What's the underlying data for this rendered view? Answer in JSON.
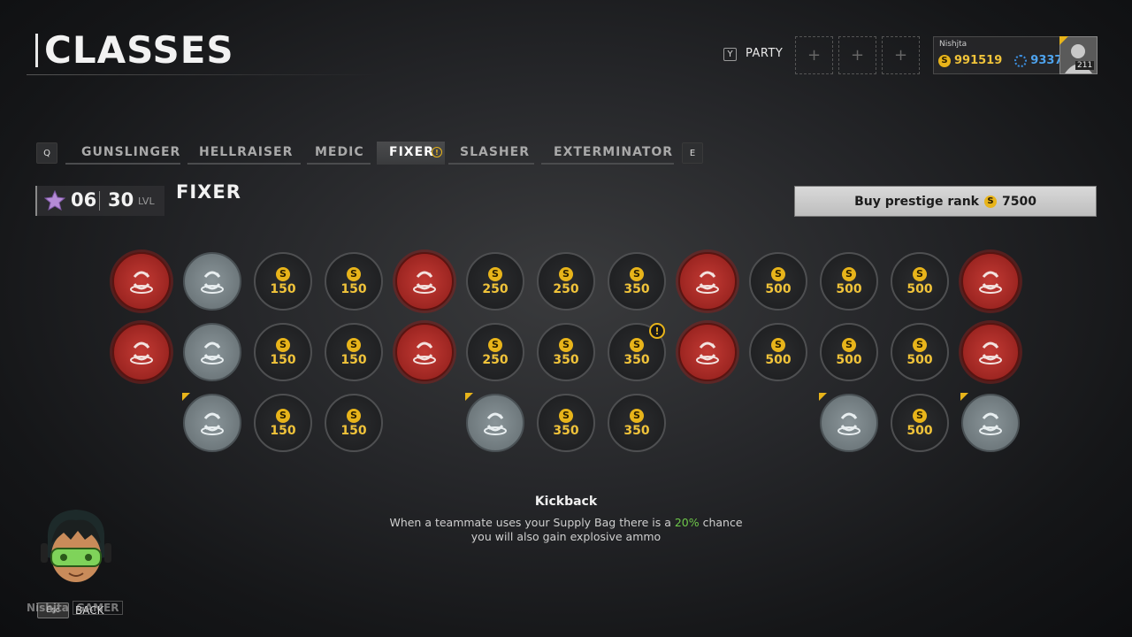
{
  "header": {
    "title": "CLASSES",
    "party_key": "Y",
    "party_label": "PARTY",
    "party_slot_symbol": "+",
    "player": {
      "name": "Nishjta",
      "coins": "991519",
      "credits": "93379",
      "level": "211"
    }
  },
  "tabs": {
    "prev_key": "Q",
    "next_key": "E",
    "items": [
      {
        "label": "GUNSLINGER"
      },
      {
        "label": "HELLRAISER"
      },
      {
        "label": "MEDIC"
      },
      {
        "label": "FIXER",
        "active": true,
        "alert": "!"
      },
      {
        "label": "SLASHER"
      },
      {
        "label": "EXTERMINATOR"
      }
    ]
  },
  "rank": {
    "prestige": "06",
    "level": "30",
    "lvl_label": "LVL"
  },
  "class_name": "FIXER",
  "buy_button": {
    "label": "Buy prestige rank",
    "cost": "7500"
  },
  "coin_symbol": "S",
  "skill_tree": {
    "rows": [
      [
        "skill-red",
        "skill-grey",
        "150",
        "150",
        "skill-red",
        "250",
        "250",
        "350",
        "skill-red",
        "500",
        "500",
        "500",
        "skill-red"
      ],
      [
        "skill-red",
        "skill-grey",
        "150",
        "150",
        "skill-red",
        "250",
        "350",
        "350",
        "skill-red",
        "500",
        "500",
        "500",
        "skill-red"
      ],
      [
        "",
        "skill-grey",
        "150",
        "150",
        "",
        "",
        "skill-grey",
        "350",
        "350",
        "",
        "",
        "skill-grey",
        "500",
        "skill-grey"
      ]
    ]
  },
  "tooltip": {
    "title": "Kickback",
    "line1_pre": "When a teammate uses your Supply Bag there is a ",
    "line1_highlight": "20%",
    "line1_post": " chance",
    "line2": "you will also gain explosive ammo"
  },
  "footer": {
    "back_key": "Esc",
    "back_label": "BACK",
    "overlay_name": "Nishjta",
    "overlay_tag": "GAMER"
  },
  "colors": {
    "gold": "#e8b41a",
    "red_skill": "#b0302b",
    "grey_skill": "#7a8488",
    "highlight": "#6ec84a",
    "credit_blue": "#4ea3ee"
  }
}
